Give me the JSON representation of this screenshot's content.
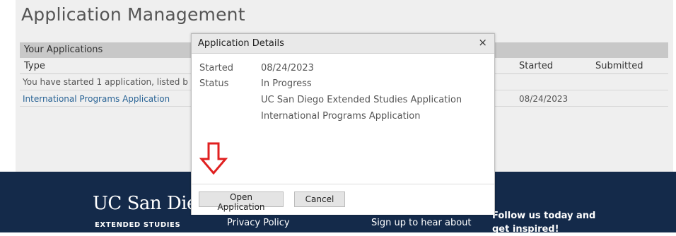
{
  "page": {
    "title": "Application Management",
    "table": {
      "header": "Your Applications",
      "columns": [
        "Type",
        "Started",
        "Submitted"
      ],
      "info": "You have started 1 application, listed b",
      "rows": [
        {
          "type": "International Programs Application",
          "started": "08/24/2023",
          "submitted": ""
        }
      ]
    }
  },
  "modal": {
    "title": "Application Details",
    "close": "×",
    "details": [
      {
        "label": "Started",
        "value": "08/24/2023"
      },
      {
        "label": "Status",
        "value": "In Progress"
      },
      {
        "label": "",
        "value": "UC San Diego Extended Studies Application"
      },
      {
        "label": "",
        "value": "International Programs Application"
      }
    ],
    "buttons": {
      "open": "Open Application",
      "cancel": "Cancel"
    }
  },
  "footer": {
    "logo_main": "UC San Dieg",
    "logo_sub": "EXTENDED STUDIES",
    "link": "Privacy Policy",
    "signup": "Sign up to hear about",
    "follow_line1": "Follow us today and",
    "follow_line2": "get inspired!"
  },
  "colors": {
    "accent_link": "#2a6496",
    "footer_bg": "#142a4a",
    "annotation_arrow": "#e02020"
  },
  "annotations": {
    "arrow_icon": "down-arrow-icon"
  }
}
